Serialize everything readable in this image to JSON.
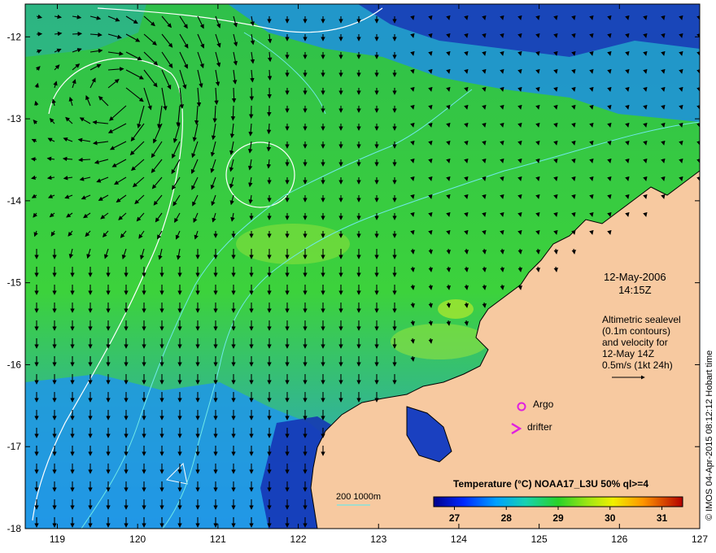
{
  "map": {
    "lon_ticks": [
      "119",
      "120",
      "121",
      "122",
      "123",
      "124",
      "125",
      "126",
      "127"
    ],
    "lat_ticks": [
      "-12",
      "-13",
      "-14",
      "-15",
      "-16",
      "-17",
      "-18"
    ],
    "lon_range": [
      118.6,
      127.0
    ],
    "lat_range": [
      -18.0,
      -11.6
    ],
    "colors": {
      "land": "#f7c9a0",
      "sea_warm": "#3cd23c",
      "sea_cool": "#1e78e6",
      "sea_cold": "#1430b4",
      "contour_white": "#ffffff",
      "contour_cyan": "#6fe8e8",
      "marker": "#e020e0"
    }
  },
  "date_label": {
    "line1": "12-May-2006",
    "line2": "14:15Z"
  },
  "altimetry": {
    "line1": "Altimetric sealevel",
    "line2": "(0.1m contours)",
    "line3": "and velocity for",
    "line4": "12-May 14Z",
    "line5": "0.5m/s (1kt 24h)"
  },
  "legend": {
    "argo": "Argo",
    "drifter": "drifter",
    "bathymetry": "200  1000m"
  },
  "colorbar": {
    "title": "Temperature (°C) NOAA17_L3U 50% ql>=4",
    "ticks": [
      "27",
      "28",
      "29",
      "30",
      "31"
    ],
    "range": [
      26.6,
      31.4
    ]
  },
  "credit": "© IMOS 04-Apr-2015 08:12:12 Hobart time"
}
